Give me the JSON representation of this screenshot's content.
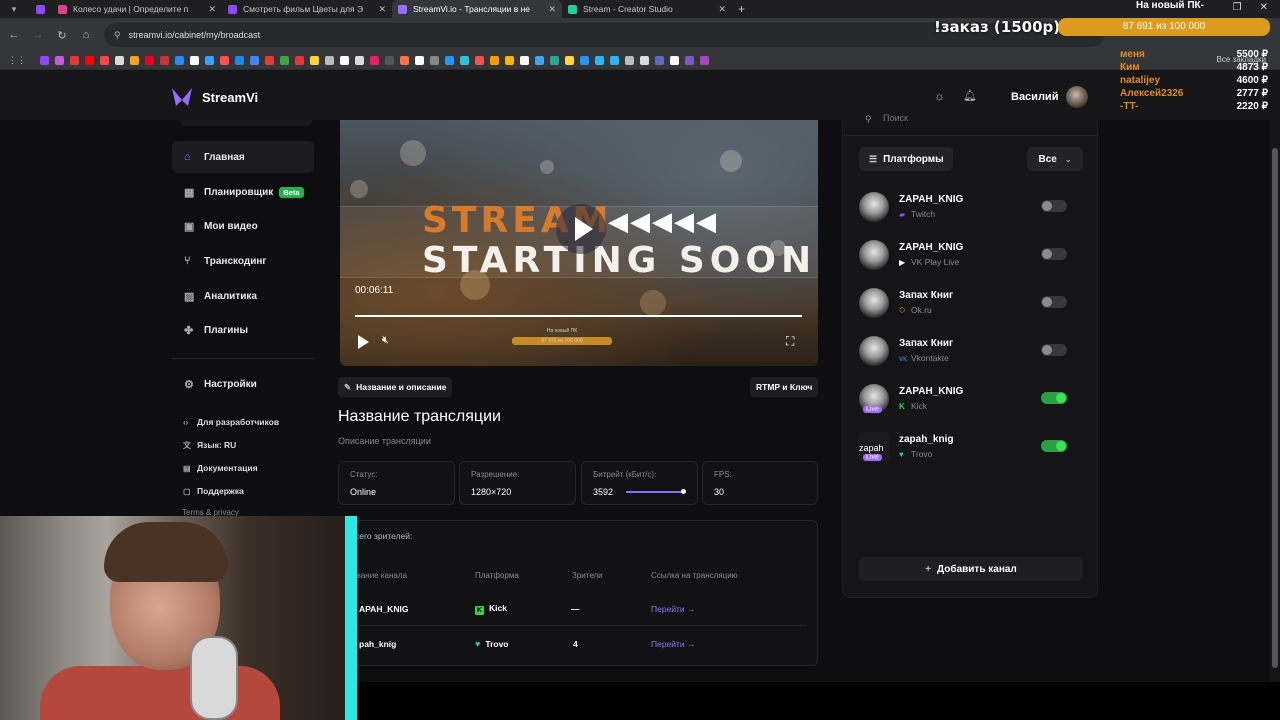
{
  "browser": {
    "tabs": [
      {
        "title": "Колесо удачи | Определите п",
        "color": "#e0408a",
        "active": false
      },
      {
        "title": "Смотреть фильм Цветы для Э",
        "color": "#9146ff",
        "active": false
      },
      {
        "title": "StreamVi.io - Трансляции в не",
        "color": "#9b6bff",
        "active": true
      },
      {
        "title": "Stream - Creator Studio",
        "color": "#1fd1a0",
        "active": false
      }
    ],
    "url": "streamvi.io/cabinet/my/broadcast",
    "bookmarks_all": "Все закладки"
  },
  "overlay": {
    "order_text": "!заказ (1500р)",
    "goal_title": "На новый ПК-",
    "goal_progress": "87 691  из 100 000",
    "donors": [
      {
        "name": "меня",
        "amount": "5500 ₽"
      },
      {
        "name": "Ким",
        "amount": "4873 ₽"
      },
      {
        "name": "natalijey",
        "amount": "4600 ₽"
      },
      {
        "name": "Алексей2326",
        "amount": "2777 ₽"
      },
      {
        "name": "-TT-",
        "amount": "2220 ₽"
      }
    ]
  },
  "header": {
    "logo": "StreamVi",
    "user_name": "Василий"
  },
  "sidebar": {
    "items": [
      {
        "label": "Главная",
        "icon": "home-icon",
        "active": true
      },
      {
        "label": "Планировщик",
        "icon": "calendar-icon",
        "badge": "Beta"
      },
      {
        "label": "Мои видео",
        "icon": "video-library-icon"
      },
      {
        "label": "Транскодинг",
        "icon": "transcoding-icon"
      },
      {
        "label": "Аналитика",
        "icon": "analytics-icon"
      },
      {
        "label": "Плагины",
        "icon": "puzzle-icon"
      },
      {
        "label": "Настройки",
        "icon": "gear-icon"
      }
    ],
    "links": [
      {
        "label": "Для разработчиков",
        "icon": "code-icon"
      },
      {
        "label": "Язык: RU",
        "icon": "language-icon"
      },
      {
        "label": "Документация",
        "icon": "document-icon"
      },
      {
        "label": "Поддержка",
        "icon": "support-icon"
      }
    ],
    "terms": "Terms & privacy"
  },
  "player": {
    "title_line1": "STREAM",
    "title_line2": "STARTING SOON",
    "arrows": "◀◀◀◀◀",
    "time": "00:06:11",
    "mini_goal_title": "На новый ПК",
    "mini_goal_bar": "87 691  из 100 000"
  },
  "broadcast": {
    "edit_tab": "Название и описание",
    "rtmp_tab": "RTMP и Ключ",
    "title": "Название трансляции",
    "description": "Описание трансляции",
    "stats": [
      {
        "label": "Статус:",
        "value": "Online"
      },
      {
        "label": "Разрешение:",
        "value": "1280×720"
      },
      {
        "label": "Битрейт (кБит/с):",
        "value": "3592"
      },
      {
        "label": "FPS:",
        "value": "30"
      }
    ]
  },
  "viewers": {
    "title": "сего зрителей:",
    "headers": [
      "звание канала",
      "Платформа",
      "Зрители",
      "Ссылка на трансляцию"
    ],
    "rows": [
      {
        "channel": "APAH_KNIG",
        "platform": "Kick",
        "viewers": "—",
        "link": "Перейти →"
      },
      {
        "channel": "pah_knig",
        "platform": "Trovo",
        "viewers": "4",
        "link": "Перейти →"
      }
    ]
  },
  "channels_panel": {
    "search_placeholder": "Поиск",
    "platforms_label": "Платформы",
    "filter_value": "Все",
    "add_channel": "Добавить канал",
    "channels": [
      {
        "name": "ZAPAH_KNIG",
        "platform": "Twitch",
        "platform_color": "#9146ff",
        "enabled": false,
        "live": false
      },
      {
        "name": "ZAPAH_KNIG",
        "platform": "VK Play Live",
        "platform_color": "#ffffff",
        "enabled": false,
        "live": false
      },
      {
        "name": "Запах Книг",
        "platform": "Ok.ru",
        "platform_color": "#f7931e",
        "enabled": false,
        "live": false
      },
      {
        "name": "Запах Книг",
        "platform": "Vkontakte",
        "platform_color": "#2787f5",
        "enabled": false,
        "live": false
      },
      {
        "name": "ZAPAH_KNIG",
        "platform": "Kick",
        "platform_color": "#36d34a",
        "enabled": true,
        "live": true,
        "live_label": "Live"
      },
      {
        "name": "zapah_knig",
        "platform": "Trovo",
        "platform_color": "#1fd1a0",
        "enabled": true,
        "live": true,
        "live_label": "Live",
        "avatar_text": "zapah"
      }
    ]
  }
}
